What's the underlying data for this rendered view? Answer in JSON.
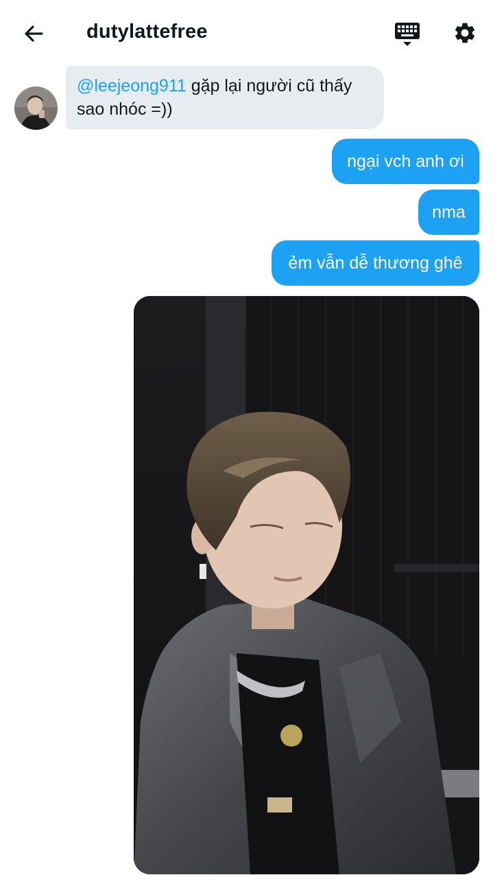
{
  "header": {
    "title": "dutylattefree",
    "back_icon": "arrow-left-icon",
    "keyboard_icon": "keyboard-icon",
    "settings_icon": "gear-icon"
  },
  "messages": {
    "incoming": {
      "mention": "@leejeong911",
      "text_line1": " gặp lại người cũ thấy",
      "text_line2": "sao nhóc =))"
    },
    "outgoing": [
      {
        "text": "ngại vch anh ơi"
      },
      {
        "text": "nma"
      },
      {
        "text": "ẻm vẫn dễ thương ghê"
      }
    ]
  },
  "colors": {
    "accent": "#1da1f2",
    "incoming_bubble": "#e6ecf0",
    "text": "#14171a"
  }
}
